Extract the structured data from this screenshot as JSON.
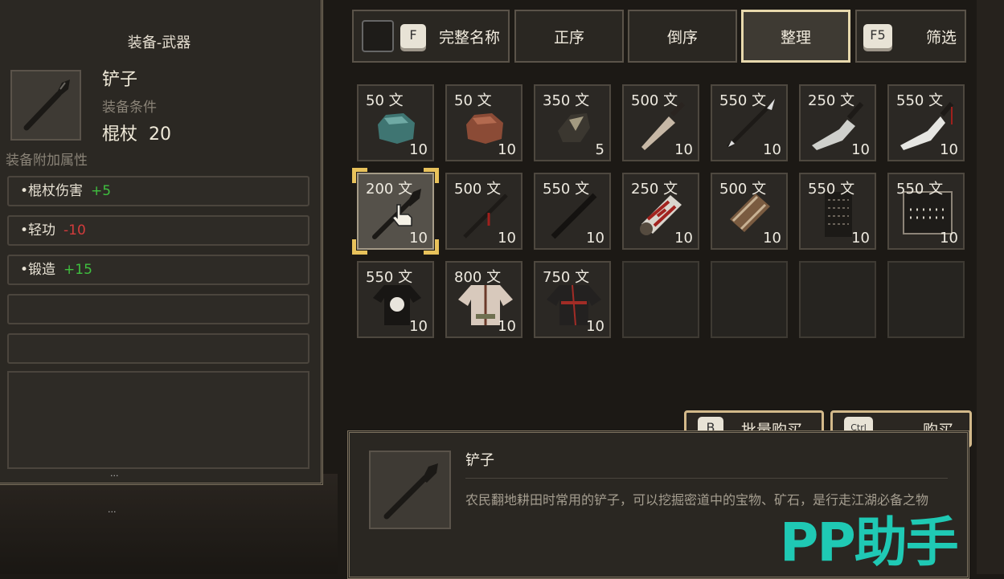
{
  "left_panel": {
    "title": "装备-武器",
    "item_name": "铲子",
    "requirement_label": "装备条件",
    "requirement_skill": "棍杖",
    "requirement_value": "20",
    "attr_heading": "装备附加属性",
    "attributes": [
      {
        "name": "•棍杖伤害",
        "value": "+5",
        "type": "positive"
      },
      {
        "name": "•轻功",
        "value": "-10",
        "type": "negative"
      },
      {
        "name": "•锻造",
        "value": "+15",
        "type": "positive"
      }
    ],
    "dots": "..."
  },
  "tabs": {
    "full_name_key": "F",
    "full_name_label": "完整名称",
    "asc_label": "正序",
    "desc_label": "倒序",
    "sort_label": "整理",
    "filter_key": "F5",
    "filter_label": "筛选"
  },
  "items": [
    {
      "price": "50 文",
      "count": "10",
      "icon": "teal-ore-icon"
    },
    {
      "price": "50 文",
      "count": "10",
      "icon": "copper-ore-icon"
    },
    {
      "price": "350 文",
      "count": "5",
      "icon": "dark-ore-icon"
    },
    {
      "price": "500 文",
      "count": "10",
      "icon": "dagger-icon"
    },
    {
      "price": "550 文",
      "count": "10",
      "icon": "spear-icon"
    },
    {
      "price": "250 文",
      "count": "10",
      "icon": "cleaver-icon"
    },
    {
      "price": "550 文",
      "count": "10",
      "icon": "machete-icon"
    },
    {
      "price": "200 文",
      "count": "10",
      "icon": "shovel-icon"
    },
    {
      "price": "500 文",
      "count": "10",
      "icon": "red-spear-icon"
    },
    {
      "price": "550 文",
      "count": "10",
      "icon": "staff-icon"
    },
    {
      "price": "250 文",
      "count": "10",
      "icon": "bandage-wrap-icon"
    },
    {
      "price": "500 文",
      "count": "10",
      "icon": "bracer-icon"
    },
    {
      "price": "550 文",
      "count": "10",
      "icon": "scale-armor-icon"
    },
    {
      "price": "550 文",
      "count": "10",
      "icon": "studded-armor-icon"
    },
    {
      "price": "550 文",
      "count": "10",
      "icon": "black-robe-icon"
    },
    {
      "price": "800 文",
      "count": "10",
      "icon": "white-robe-icon"
    },
    {
      "price": "750 文",
      "count": "10",
      "icon": "red-black-robe-icon"
    }
  ],
  "buttons": {
    "bulk_key": "B",
    "bulk_label": "批量购买",
    "buy_key": "Ctrl",
    "buy_label": "购买"
  },
  "detail": {
    "name": "铲子",
    "description": "农民翻地耕田时常用的铲子，可以挖掘密道中的宝物、矿石，是行走江湖必备之物"
  },
  "watermark": "PP助手",
  "colors": {
    "positive": "#3fbf3f",
    "negative": "#d23c3c",
    "selection_corner": "#e8c25b",
    "watermark": "#1fc9b4"
  }
}
